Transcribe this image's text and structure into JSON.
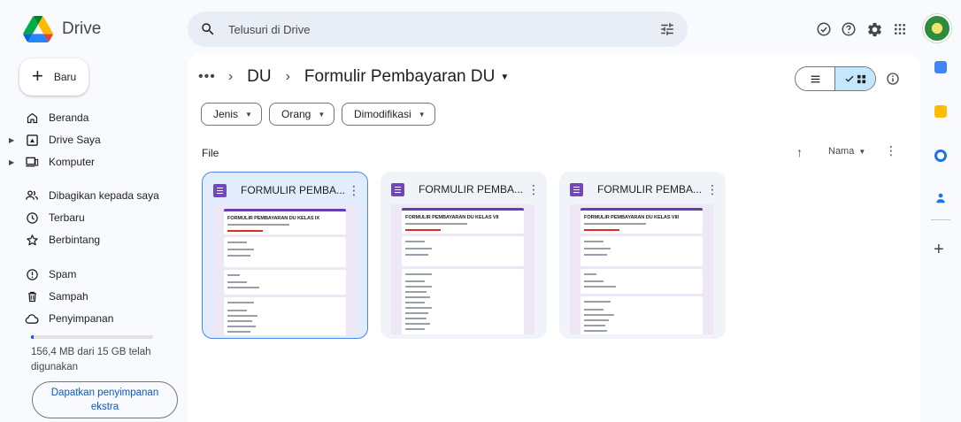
{
  "app": {
    "title": "Drive"
  },
  "search": {
    "placeholder": "Telusuri di Drive"
  },
  "header_icons": [
    "status-ready-icon",
    "help-icon",
    "settings-icon",
    "apps-grid-icon",
    "account-avatar"
  ],
  "sidebar": {
    "new_label": "Baru",
    "items": [
      {
        "label": "Beranda",
        "icon": "home-icon",
        "expandable": false
      },
      {
        "label": "Drive Saya",
        "icon": "my-drive-icon",
        "expandable": true
      },
      {
        "label": "Komputer",
        "icon": "computer-icon",
        "expandable": true
      },
      {
        "label": "Dibagikan kepada saya",
        "icon": "shared-people-icon",
        "expandable": false
      },
      {
        "label": "Terbaru",
        "icon": "clock-icon",
        "expandable": false
      },
      {
        "label": "Berbintang",
        "icon": "star-icon",
        "expandable": false
      },
      {
        "label": "Spam",
        "icon": "spam-icon",
        "expandable": false
      },
      {
        "label": "Sampah",
        "icon": "trash-icon",
        "expandable": false
      },
      {
        "label": "Penyimpanan",
        "icon": "cloud-icon",
        "expandable": false
      }
    ],
    "storage": {
      "used_fraction": 0.0104,
      "text": "156,4 MB dari 15 GB telah digunakan"
    },
    "get_storage_label": "Dapatkan penyimpanan ekstra"
  },
  "breadcrumb": {
    "overflow": "•••",
    "parent": "DU",
    "current": "Formulir Pembayaran DU"
  },
  "filters": [
    "Jenis",
    "Orang",
    "Dimodifikasi"
  ],
  "section": {
    "title": "File",
    "sort_label": "Nama"
  },
  "files": [
    {
      "title": "FORMULIR PEMBA...",
      "thumb_title": "FORMULIR PEMBAYARAN DU KELAS IX",
      "selected": true
    },
    {
      "title": "FORMULIR PEMBA...",
      "thumb_title": "FORMULIR PEMBAYARAN DU KELAS VII",
      "selected": false
    },
    {
      "title": "FORMULIR PEMBA...",
      "thumb_title": "FORMULIR PEMBAYARAN DU KELAS VIII",
      "selected": false
    }
  ],
  "colors": {
    "accent": "#0b57d0",
    "selected_bg": "#c2e7ff",
    "forms_purple": "#673ab7",
    "background": "#f8fafd"
  }
}
